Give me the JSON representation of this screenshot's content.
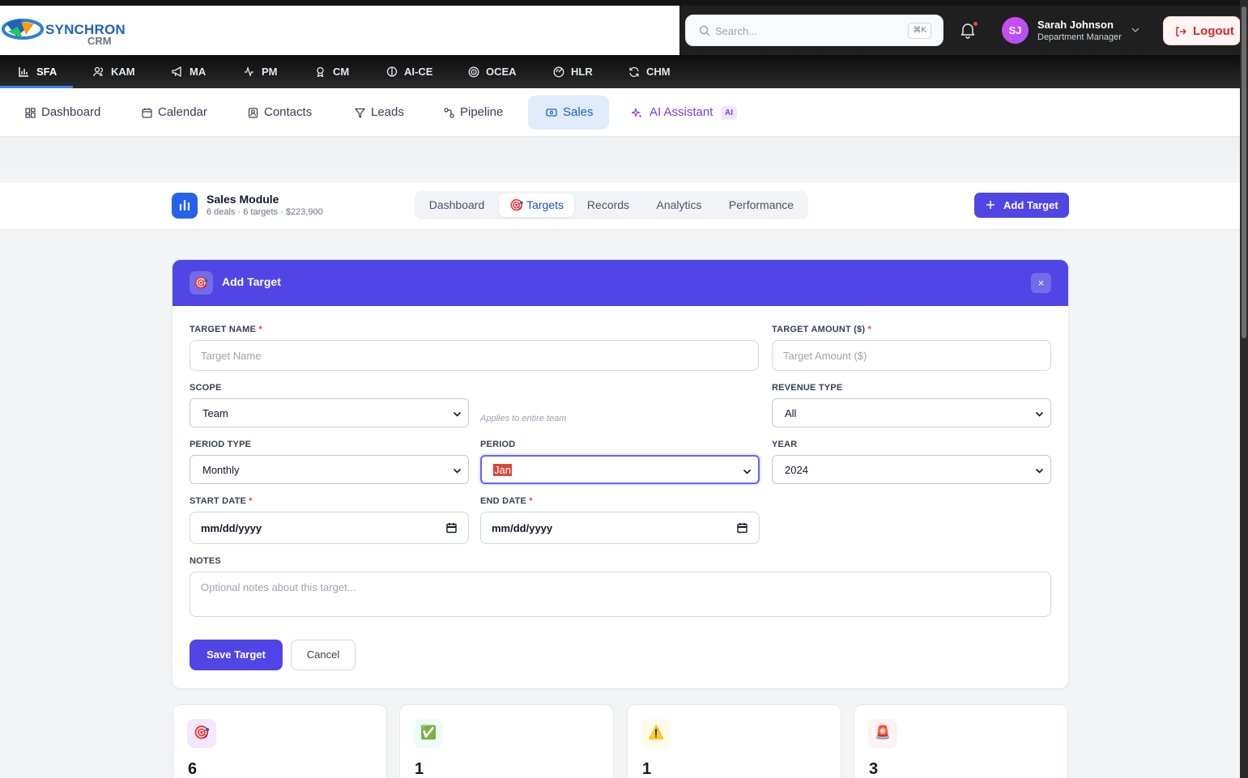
{
  "brand": {
    "name": "SYNCHRON",
    "sub": "CRM"
  },
  "search": {
    "placeholder": "Search...",
    "shortcut": "⌘K"
  },
  "user": {
    "initials": "SJ",
    "name": "Sarah Johnson",
    "role": "Department Manager"
  },
  "logout_label": "Logout",
  "modules": [
    {
      "label": "SFA",
      "icon": "bar-chart-icon"
    },
    {
      "label": "KAM",
      "icon": "users-icon"
    },
    {
      "label": "MA",
      "icon": "megaphone-icon"
    },
    {
      "label": "PM",
      "icon": "activity-icon"
    },
    {
      "label": "CM",
      "icon": "award-icon"
    },
    {
      "label": "AI-CE",
      "icon": "brain-icon"
    },
    {
      "label": "OCEA",
      "icon": "target-icon"
    },
    {
      "label": "HLR",
      "icon": "radar-icon"
    },
    {
      "label": "CHM",
      "icon": "refresh-icon"
    }
  ],
  "subnav": [
    {
      "label": "Dashboard",
      "icon": "grid-icon"
    },
    {
      "label": "Calendar",
      "icon": "calendar-icon"
    },
    {
      "label": "Contacts",
      "icon": "contact-icon"
    },
    {
      "label": "Leads",
      "icon": "filter-icon"
    },
    {
      "label": "Pipeline",
      "icon": "pipeline-icon"
    },
    {
      "label": "Sales",
      "icon": "ticket-icon"
    },
    {
      "label": "AI Assistant",
      "icon": "sparkles-icon",
      "badge": "AI"
    }
  ],
  "sales_module": {
    "title": "Sales Module",
    "subtitle": "6 deals · 6 targets · $223,900",
    "tabs": [
      "Dashboard",
      "🎯 Targets",
      "Records",
      "Analytics",
      "Performance"
    ],
    "active_tab": "🎯 Targets",
    "add_button": "Add Target"
  },
  "form": {
    "title": "Add Target",
    "close": "×",
    "target_name_label": "TARGET NAME",
    "target_name_placeholder": "Target Name",
    "target_amount_label": "TARGET AMOUNT ($)",
    "target_amount_placeholder": "Target Amount ($)",
    "required_mark": "*",
    "scope_label": "SCOPE",
    "scope_value": "Team",
    "scope_hint": "Applies to entire team",
    "revenue_type_label": "REVENUE TYPE",
    "revenue_type_value": "All",
    "period_type_label": "PERIOD TYPE",
    "period_type_value": "Monthly",
    "period_label": "PERIOD",
    "period_value": "Jan",
    "year_label": "YEAR",
    "year_value": "2024",
    "start_date_label": "START DATE",
    "start_date_value": "mm/dd/yyyy",
    "end_date_label": "END DATE",
    "end_date_value": "mm/dd/yyyy",
    "notes_label": "NOTES",
    "notes_placeholder": "Optional notes about this target...",
    "save_label": "Save Target",
    "cancel_label": "Cancel"
  },
  "stats": [
    {
      "icon": "🎯",
      "value": "6",
      "color": "#f3e8ff"
    },
    {
      "icon": "✅",
      "value": "1",
      "color": "#ecfdf5"
    },
    {
      "icon": "⚠️",
      "value": "1",
      "color": "#fefce8"
    },
    {
      "icon": "🚨",
      "value": "3",
      "color": "#fef2f2"
    }
  ]
}
